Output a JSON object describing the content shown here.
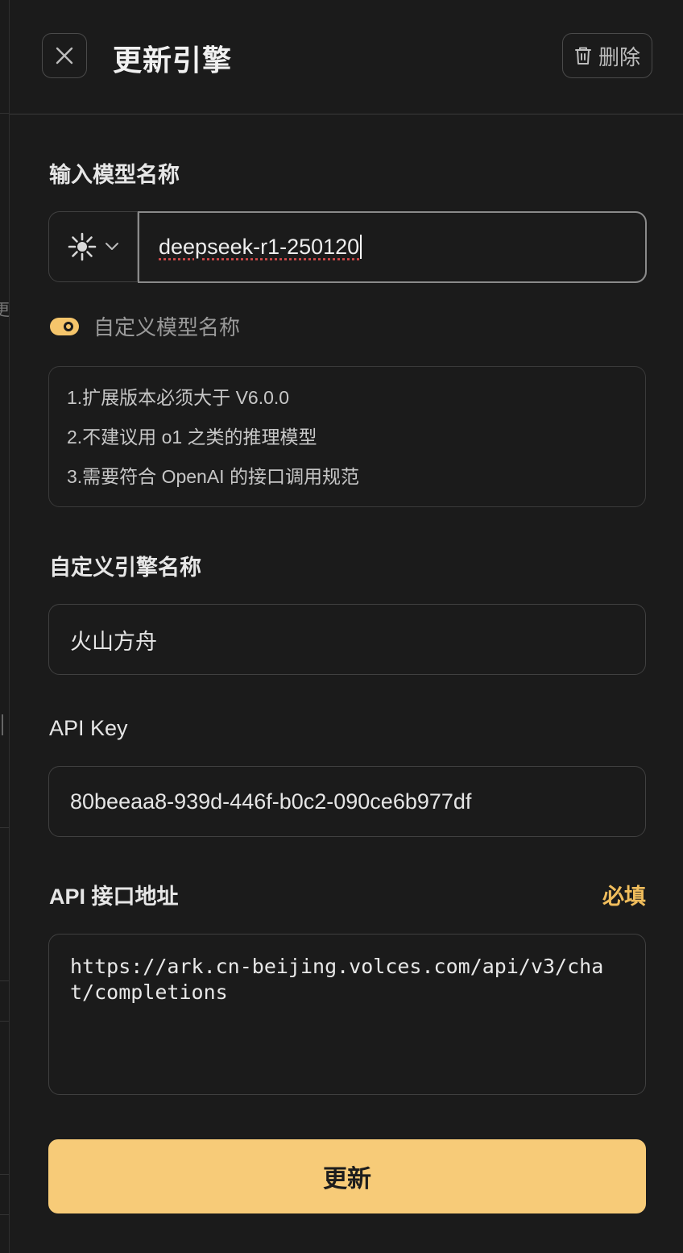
{
  "header": {
    "title": "更新引擎",
    "delete_label": "删除"
  },
  "model": {
    "section_label": "输入模型名称",
    "input_value": "deepseek-r1-250120",
    "provider_icon": "sparkle-icon"
  },
  "custom_model_toggle": {
    "label": "自定义模型名称",
    "enabled": true
  },
  "notes": [
    "1.扩展版本必须大于 V6.0.0",
    "2.不建议用 o1 之类的推理模型",
    "3.需要符合 OpenAI 的接口调用规范"
  ],
  "engine_name": {
    "label": "自定义引擎名称",
    "value": "火山方舟"
  },
  "api_key": {
    "label": "API Key",
    "value": "80beeaa8-939d-446f-b0c2-090ce6b977df"
  },
  "api_url": {
    "label": "API 接口地址",
    "required_label": "必填",
    "value": "https://ark.cn-beijing.volces.com/api/v3/chat/completions"
  },
  "submit_label": "更新",
  "colors": {
    "background": "#1b1b1b",
    "accent": "#f7cb78",
    "required": "#f0bd5c"
  },
  "side_glyph": "更"
}
